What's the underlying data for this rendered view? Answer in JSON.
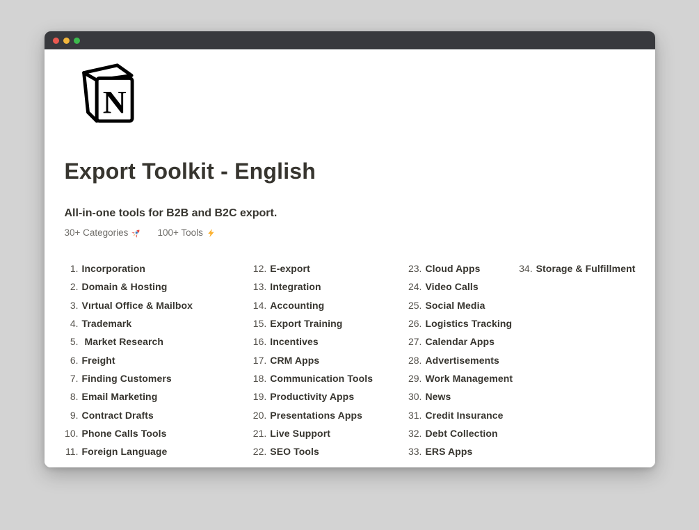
{
  "colors": {
    "desktop_bg": "#d3d3d3",
    "titlebar_bg": "#38393d",
    "close_button": "#ea5950",
    "minimize_button": "#f2b63c",
    "maximize_button": "#3dbb4d",
    "text_primary": "#37352f",
    "text_muted": "#72706c",
    "page_bg": "#ffffff"
  },
  "page": {
    "logo_name": "notion-logo",
    "title": "Export Toolkit - English",
    "subtitle": "All-in-one tools for B2B and B2C export.",
    "meta": {
      "categories_label": "30+ Categories",
      "categories_emoji": "🚀",
      "tools_label": "100+ Tools",
      "tools_emoji": "⚡"
    }
  },
  "list": {
    "columns": [
      [
        {
          "num": "1.",
          "label": "Incorporation"
        },
        {
          "num": "2.",
          "label": "Domain & Hosting"
        },
        {
          "num": "3.",
          "label": "Vırtual Office & Mailbox"
        },
        {
          "num": "4.",
          "label": "Trademark"
        },
        {
          "num": "5.",
          "label": " Market Research"
        },
        {
          "num": "6.",
          "label": "Freight"
        },
        {
          "num": "7.",
          "label": "Finding Customers"
        },
        {
          "num": "8.",
          "label": "Email Marketing"
        },
        {
          "num": "9.",
          "label": "Contract Drafts"
        },
        {
          "num": "10.",
          "label": "Phone Calls Tools"
        },
        {
          "num": "11.",
          "label": "Foreign Language"
        }
      ],
      [
        {
          "num": "12.",
          "label": "E-export"
        },
        {
          "num": "13.",
          "label": "Integration"
        },
        {
          "num": "14.",
          "label": "Accounting"
        },
        {
          "num": "15.",
          "label": "Export Training"
        },
        {
          "num": "16.",
          "label": "Incentives"
        },
        {
          "num": "17.",
          "label": "CRM Apps"
        },
        {
          "num": "18.",
          "label": "Communication Tools"
        },
        {
          "num": "19.",
          "label": "Productivity Apps"
        },
        {
          "num": "20.",
          "label": "Presentations Apps"
        },
        {
          "num": "21.",
          "label": "Live Support"
        },
        {
          "num": "22.",
          "label": "SEO Tools"
        }
      ],
      [
        {
          "num": "23.",
          "label": "Cloud Apps"
        },
        {
          "num": "24.",
          "label": "Video Calls"
        },
        {
          "num": "25.",
          "label": "Social Media"
        },
        {
          "num": "26.",
          "label": "Logistics Tracking"
        },
        {
          "num": "27.",
          "label": "Calendar Apps"
        },
        {
          "num": "28.",
          "label": "Advertisements"
        },
        {
          "num": "29.",
          "label": "Work Management"
        },
        {
          "num": "30.",
          "label": "News"
        },
        {
          "num": "31.",
          "label": "Credit Insurance"
        },
        {
          "num": "32.",
          "label": "Debt Collection"
        },
        {
          "num": "33.",
          "label": "ERS Apps"
        }
      ],
      [
        {
          "num": "34.",
          "label": "Storage & Fulfillment"
        }
      ]
    ]
  }
}
